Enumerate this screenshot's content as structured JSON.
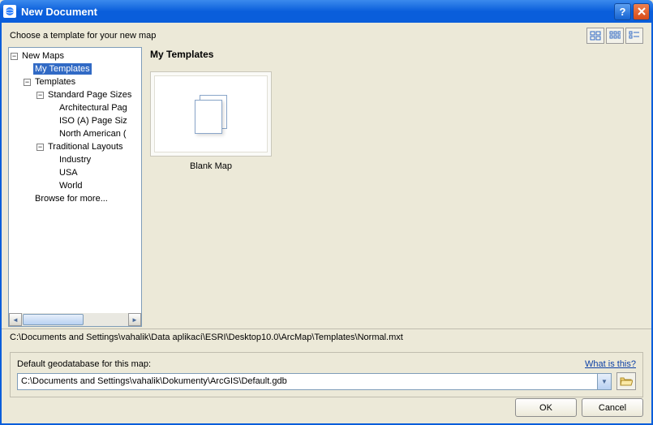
{
  "title": "New Document",
  "prompt": "Choose a template for your new map",
  "tree": {
    "root": "New Maps",
    "my_templates": "My Templates",
    "templates": "Templates",
    "std_page": "Standard Page Sizes",
    "arch": "Architectural Pag",
    "iso": "ISO (A) Page Siz",
    "na": "North American (",
    "trad": "Traditional Layouts",
    "industry": "Industry",
    "usa": "USA",
    "world": "World",
    "browse": "Browse for more..."
  },
  "right": {
    "heading": "My Templates",
    "item_name": "Blank Map"
  },
  "path_line": "C:\\Documents and Settings\\vahalik\\Data aplikací\\ESRI\\Desktop10.0\\ArcMap\\Templates\\Normal.mxt",
  "gdb": {
    "label": "Default geodatabase for this map:",
    "what": "What is this?",
    "value": "C:\\Documents and Settings\\vahalik\\Dokumenty\\ArcGIS\\Default.gdb"
  },
  "buttons": {
    "ok": "OK",
    "cancel": "Cancel"
  }
}
